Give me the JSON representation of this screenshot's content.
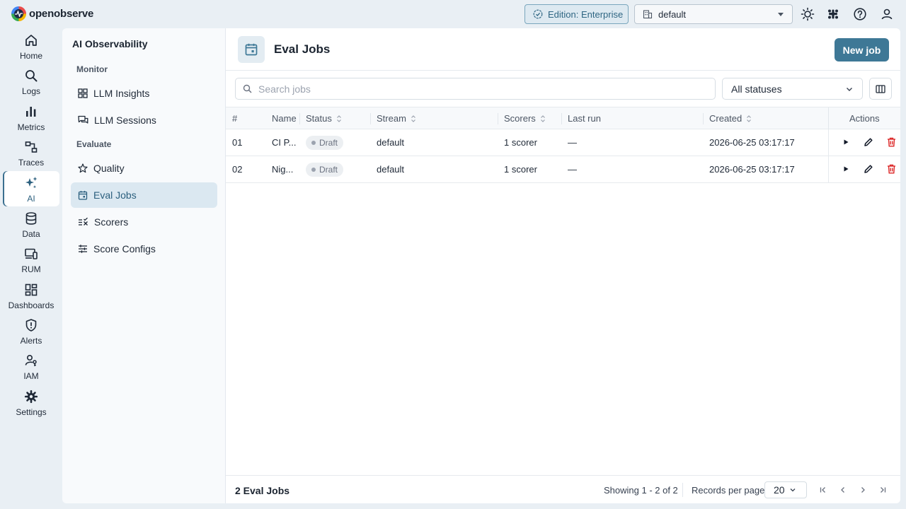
{
  "app": {
    "brand": "openobserve"
  },
  "topbar": {
    "edition_label": "Edition: Enterprise",
    "org_selector": "default",
    "icons": [
      "theme-toggle-icon",
      "slack-icon",
      "help-icon",
      "user-icon"
    ]
  },
  "nav": {
    "items": [
      {
        "label": "Home",
        "icon": "home-icon"
      },
      {
        "label": "Logs",
        "icon": "search-icon"
      },
      {
        "label": "Metrics",
        "icon": "bar-chart-icon"
      },
      {
        "label": "Traces",
        "icon": "traces-icon"
      },
      {
        "label": "AI",
        "icon": "sparkle-icon",
        "active": true
      },
      {
        "label": "Data",
        "icon": "database-icon"
      },
      {
        "label": "RUM",
        "icon": "devices-icon"
      },
      {
        "label": "Dashboards",
        "icon": "dashboard-grid-icon"
      },
      {
        "label": "Alerts",
        "icon": "shield-alert-icon"
      },
      {
        "label": "IAM",
        "icon": "users-key-icon"
      },
      {
        "label": "Settings",
        "icon": "gear-icon"
      }
    ]
  },
  "subnav": {
    "title": "AI Observability",
    "sections": {
      "monitor": "Monitor",
      "evaluate": "Evaluate"
    },
    "items": [
      {
        "label": "LLM Insights",
        "icon": "grid-icon"
      },
      {
        "label": "LLM Sessions",
        "icon": "chat-icon"
      },
      {
        "label": "Quality",
        "icon": "star-icon"
      },
      {
        "label": "Eval Jobs",
        "icon": "calendar-icon",
        "active": true
      },
      {
        "label": "Scorers",
        "icon": "list-check-icon"
      },
      {
        "label": "Score Configs",
        "icon": "sliders-icon"
      }
    ]
  },
  "page": {
    "title": "Eval Jobs",
    "new_button": "New job",
    "search_placeholder": "Search jobs",
    "status_filter": "All statuses"
  },
  "table": {
    "columns": [
      "#",
      "Name",
      "Status",
      "Stream",
      "Scorers",
      "Last run",
      "Created",
      "Actions"
    ],
    "rows": [
      {
        "num": "01",
        "name": "CI P...",
        "status": "Draft",
        "stream": "default",
        "scorers": "1 scorer",
        "last_run": "—",
        "created": "2026-06-25 03:17:17"
      },
      {
        "num": "02",
        "name": "Nig...",
        "status": "Draft",
        "stream": "default",
        "scorers": "1 scorer",
        "last_run": "—",
        "created": "2026-06-25 03:17:17"
      }
    ]
  },
  "footer": {
    "count": "2 Eval Jobs",
    "showing": "Showing 1 - 2 of 2",
    "rpp_label": "Records per page",
    "rpp_value": "20"
  },
  "colors": {
    "accent": "#3e7896",
    "danger": "#dc2626",
    "background": "#e9eff4"
  }
}
